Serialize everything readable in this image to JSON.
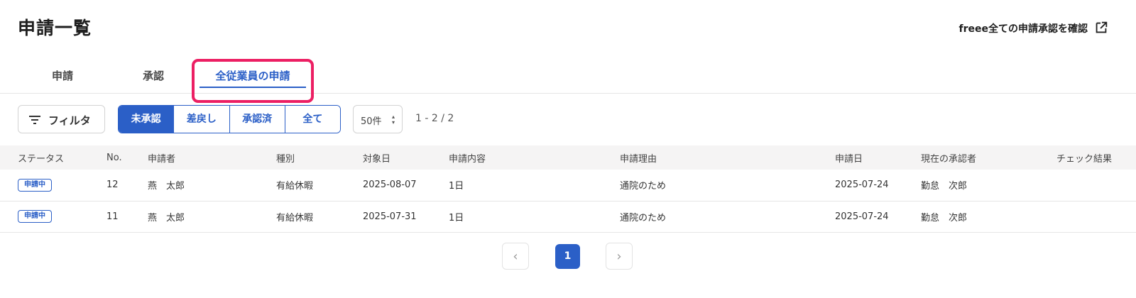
{
  "header": {
    "title": "申請一覧",
    "external_link_label": "freee全ての申請承認を確認"
  },
  "tabs": [
    {
      "label": "申請"
    },
    {
      "label": "承認"
    },
    {
      "label": "全従業員の申請",
      "active": true
    }
  ],
  "toolbar": {
    "filter_label": "フィルタ",
    "segments": [
      "未承認",
      "差戻し",
      "承認済",
      "全て"
    ],
    "selected_segment": "未承認",
    "per_page": "50件",
    "range": "1 - 2 / 2"
  },
  "table": {
    "headers": {
      "status": "ステータス",
      "no": "No.",
      "applicant": "申請者",
      "type": "種別",
      "target_date": "対象日",
      "content": "申請内容",
      "reason": "申請理由",
      "applied_date": "申請日",
      "approver": "現在の承認者",
      "check": "チェック結果"
    },
    "rows": [
      {
        "status": "申請中",
        "no": "12",
        "applicant": "燕　太郎",
        "type": "有給休暇",
        "target_date": "2025-08-07",
        "content": "1日",
        "reason": "通院のため",
        "applied_date": "2025-07-24",
        "approver": "勤怠　次郎",
        "check": ""
      },
      {
        "status": "申請中",
        "no": "11",
        "applicant": "燕　太郎",
        "type": "有給休暇",
        "target_date": "2025-07-31",
        "content": "1日",
        "reason": "通院のため",
        "applied_date": "2025-07-24",
        "approver": "勤怠　次郎",
        "check": ""
      }
    ]
  },
  "pagination": {
    "current_page": "1",
    "prev_icon": "‹",
    "next_icon": "›"
  },
  "icons": {
    "external": "external-link-icon",
    "filter": "filter-icon"
  },
  "colors": {
    "accent": "#2b5fc7",
    "highlight": "#ec1f63"
  }
}
